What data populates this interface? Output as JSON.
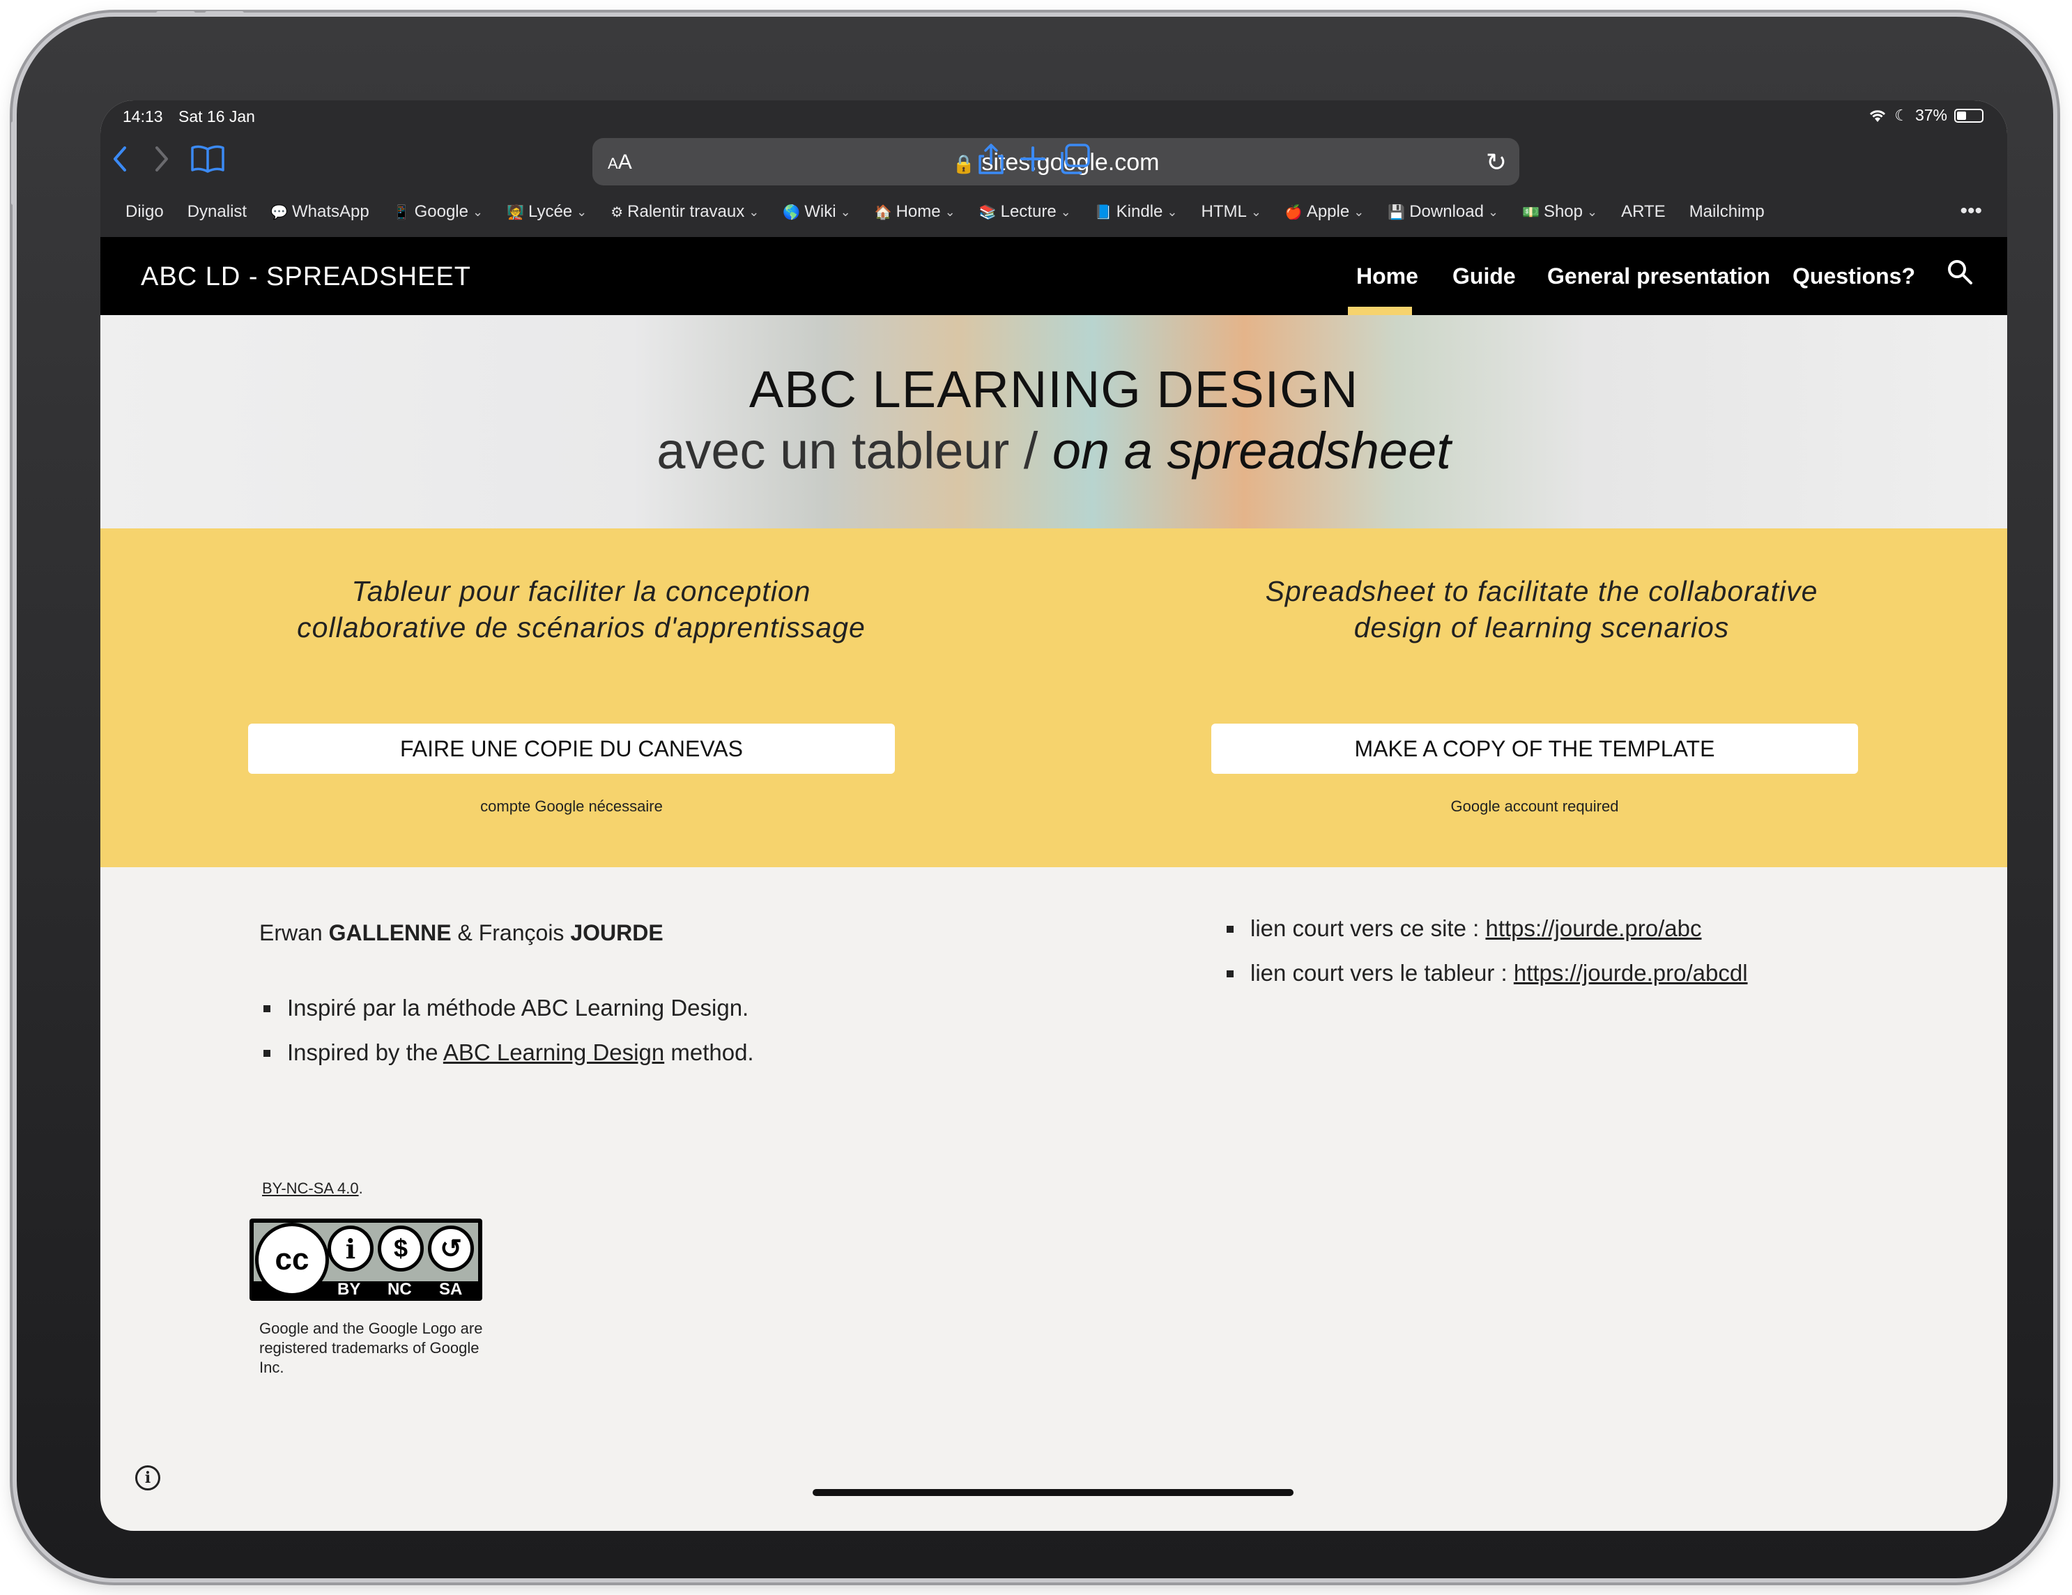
{
  "status": {
    "time": "14:13",
    "date": "Sat 16 Jan",
    "battery": "37%",
    "battery_level": 0.37
  },
  "browser": {
    "url": "sites.google.com",
    "aa_label": "AA",
    "icons": [
      "back-icon",
      "forward-icon",
      "bookmarks-book-icon",
      "lock-icon",
      "reload-icon",
      "share-icon",
      "new-tab-plus-icon",
      "tabs-icon"
    ],
    "bookmarks": [
      {
        "label": "Diigo",
        "icon": "",
        "folder": false
      },
      {
        "label": "Dynalist",
        "icon": "",
        "folder": false
      },
      {
        "label": "WhatsApp",
        "icon": "💬",
        "folder": false
      },
      {
        "label": "Google",
        "icon": "📱",
        "folder": true
      },
      {
        "label": "Lycée",
        "icon": "🧑‍🏫",
        "folder": true
      },
      {
        "label": "Ralentir travaux",
        "icon": "⚙",
        "folder": true
      },
      {
        "label": "Wiki",
        "icon": "🌎",
        "folder": true
      },
      {
        "label": "Home",
        "icon": "🏠",
        "folder": true
      },
      {
        "label": "Lecture",
        "icon": "📚",
        "folder": true
      },
      {
        "label": "Kindle",
        "icon": "📘",
        "folder": true
      },
      {
        "label": "HTML",
        "icon": "",
        "folder": true
      },
      {
        "label": "Apple",
        "icon": "🍎",
        "folder": true
      },
      {
        "label": "Download",
        "icon": "💾",
        "folder": true
      },
      {
        "label": "Shop",
        "icon": "💵",
        "folder": true
      },
      {
        "label": "ARTE",
        "icon": "",
        "folder": false
      },
      {
        "label": "Mailchimp",
        "icon": "",
        "folder": false
      }
    ],
    "more_label": "•••"
  },
  "site": {
    "title": "ABC LD - SPREADSHEET",
    "nav": [
      "Home",
      "Guide",
      "General presentation",
      "Questions?"
    ],
    "active_nav": "Home",
    "hero": {
      "title": "ABC LEARNING DESIGN",
      "sub_plain": "avec un tableur / ",
      "sub_italic": "on a spreadsheet"
    },
    "left": {
      "line1": "Tableur pour faciliter la conception",
      "line2": "collaborative de scénarios d'apprentissage",
      "button": "FAIRE UNE COPIE DU CANEVAS",
      "note": "compte Google nécessaire"
    },
    "right": {
      "line1": "Spreadsheet to facilitate the collaborative",
      "line2": "design of learning scenarios",
      "button": "MAKE A COPY OF THE TEMPLATE",
      "note": "Google account required"
    },
    "authors": {
      "first1": "Erwan ",
      "last1": "GALLENNE",
      "and": " & ",
      "first2": "François ",
      "last2": "JOURDE"
    },
    "inspired": {
      "fr": "Inspiré par la méthode ABC Learning Design.",
      "en_pre": "Inspired by the ",
      "en_link": "ABC Learning Design",
      "en_post": " method."
    },
    "links": {
      "site_label": "lien court vers ce site : ",
      "site_url": "https://jourde.pro/abc",
      "sheet_label": "lien court vers le tableur : ",
      "sheet_url": "https://jourde.pro/abcdl"
    },
    "license": {
      "link": " BY-NC-SA 4.0",
      "suffix": ".",
      "badge_labels": [
        "BY",
        "NC",
        "SA"
      ],
      "badge_glyphs": [
        "cc",
        "i",
        "$",
        "↺"
      ]
    },
    "trademark": "Google and the Google Logo are registered trademarks of Google Inc.",
    "info_glyph": "i"
  }
}
